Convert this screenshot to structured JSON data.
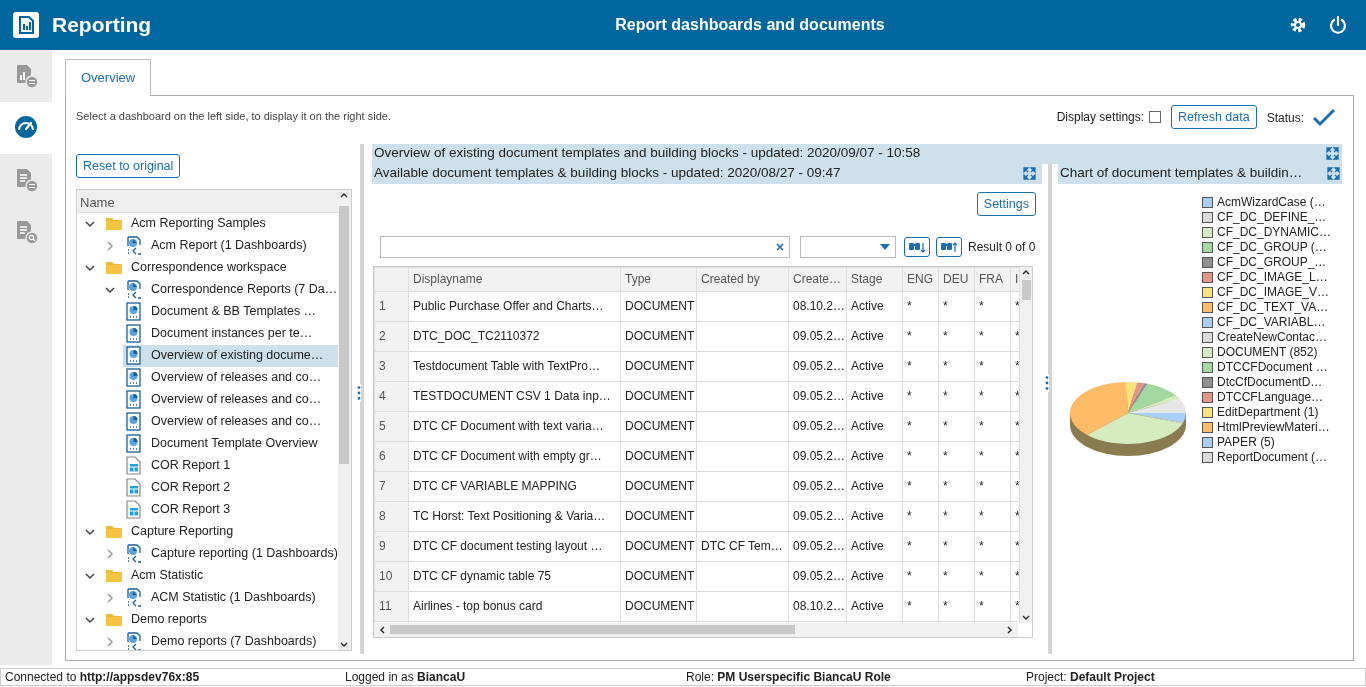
{
  "header": {
    "title": "Reporting",
    "subtitle": "Report dashboards and documents"
  },
  "sidebar": {
    "items": [
      {
        "kind": "report-settings",
        "selected": false
      },
      {
        "kind": "gauge",
        "selected": true
      },
      {
        "kind": "document-settings",
        "selected": false
      },
      {
        "kind": "document-search",
        "selected": false
      }
    ]
  },
  "tabs": [
    {
      "label": "Overview",
      "selected": true
    }
  ],
  "instruction": "Select a dashboard on the left side, to display it on the right side.",
  "display_settings": {
    "label": "Display settings:",
    "checked": false
  },
  "refresh_button": "Refresh data",
  "status": {
    "label": "Status:",
    "ok": true
  },
  "reset_button": "Reset to original",
  "tree": {
    "column": "Name",
    "items": [
      {
        "label": "Acm Reporting Samples",
        "kind": "folder",
        "expanded": true,
        "selected": false,
        "children": [
          {
            "label": "Acm Report (1 Dashboards)",
            "kind": "dashboard",
            "expanded": false,
            "selected": false
          }
        ]
      },
      {
        "label": "Correspondence workspace",
        "kind": "folder",
        "expanded": true,
        "selected": false,
        "children": [
          {
            "label": "Correspondence Reports (7 Da…",
            "kind": "dashboard",
            "expanded": true,
            "selected": false,
            "children": [
              {
                "label": "Document & BB Templates …",
                "kind": "chart",
                "selected": false
              },
              {
                "label": "Document instances per te…",
                "kind": "chart",
                "selected": false
              },
              {
                "label": "Overview of existing docume…",
                "kind": "chart",
                "selected": true
              },
              {
                "label": "Overview of releases and co…",
                "kind": "chart",
                "selected": false
              },
              {
                "label": "Overview of releases and co…",
                "kind": "chart",
                "selected": false
              },
              {
                "label": "Overview of releases and co…",
                "kind": "chart",
                "selected": false
              },
              {
                "label": "Document Template Overview",
                "kind": "chart",
                "selected": false
              },
              {
                "label": "COR Report 1",
                "kind": "report",
                "selected": false
              },
              {
                "label": "COR Report 2",
                "kind": "report",
                "selected": false
              },
              {
                "label": "COR Report 3",
                "kind": "report",
                "selected": false
              }
            ]
          }
        ]
      },
      {
        "label": "Capture Reporting",
        "kind": "folder",
        "expanded": true,
        "selected": false,
        "children": [
          {
            "label": "Capture reporting (1 Dashboards)",
            "kind": "dashboard",
            "expanded": false,
            "selected": false
          }
        ]
      },
      {
        "label": "Acm Statistic",
        "kind": "folder",
        "expanded": true,
        "selected": false,
        "children": [
          {
            "label": "ACM Statistic (1 Dashboards)",
            "kind": "dashboard",
            "expanded": false,
            "selected": false
          }
        ]
      },
      {
        "label": "Demo reports",
        "kind": "folder",
        "expanded": true,
        "selected": false,
        "children": [
          {
            "label": "Demo reports (7 Dashboards)",
            "kind": "dashboard",
            "expanded": false,
            "selected": false
          }
        ]
      }
    ]
  },
  "dashboard": {
    "title": "Overview of existing document templates and building blocks - updated: 2020/09/07 - 10:58",
    "table_panel": {
      "title": "Available document templates & building blocks - updated: 2020/08/27 - 09:47",
      "settings_button": "Settings",
      "result": "Result 0 of 0",
      "table": {
        "columns": [
          "",
          "Displayname",
          "Type",
          "Created by",
          "Create…",
          "Stage",
          "ENG",
          "DEU",
          "FRA",
          "I"
        ],
        "rows": [
          [
            "1",
            "Public Purchase Offer and Charts…",
            "DOCUMENT",
            "",
            "08.10.2…",
            "Active",
            "*",
            "*",
            "*",
            "*"
          ],
          [
            "2",
            "DTC_DOC_TC2110372",
            "DOCUMENT",
            "",
            "09.05.2…",
            "Active",
            "*",
            "*",
            "*",
            "*"
          ],
          [
            "3",
            "Testdocument Table with TextPro…",
            "DOCUMENT",
            "",
            "09.05.2…",
            "Active",
            "*",
            "*",
            "*",
            "*"
          ],
          [
            "4",
            "TESTDOCUMENT CSV 1 Data inp…",
            "DOCUMENT",
            "",
            "09.05.2…",
            "Active",
            "*",
            "*",
            "*",
            "*"
          ],
          [
            "5",
            "DTC CF Document with text varia…",
            "DOCUMENT",
            "",
            "09.05.2…",
            "Active",
            "*",
            "*",
            "*",
            "*"
          ],
          [
            "6",
            "DTC CF Document with empty gr…",
            "DOCUMENT",
            "",
            "09.05.2…",
            "Active",
            "*",
            "*",
            "*",
            "*"
          ],
          [
            "7",
            "DTC CF VARIABLE MAPPING",
            "DOCUMENT",
            "",
            "09.05.2…",
            "Active",
            "*",
            "*",
            "*",
            "*"
          ],
          [
            "8",
            "TC Horst: Text Positioning & Varia…",
            "DOCUMENT",
            "",
            "09.05.2…",
            "Active",
            "*",
            "*",
            "*",
            "*"
          ],
          [
            "9",
            "DTC CF document testing layout …",
            "DOCUMENT",
            "DTC CF Tem…",
            "09.05.2…",
            "Active",
            "*",
            "*",
            "*",
            "*"
          ],
          [
            "10",
            "DTC CF dynamic table 75",
            "DOCUMENT",
            "",
            "09.05.2…",
            "Active",
            "*",
            "*",
            "*",
            "*"
          ],
          [
            "11",
            "Airlines - top bonus card",
            "DOCUMENT",
            "",
            "08.10.2…",
            "Active",
            "*",
            "*",
            "*",
            "*"
          ]
        ]
      }
    },
    "chart_panel": {
      "title": "Chart of document templates & buildin…",
      "legend": [
        {
          "label": "AcmWizardCase (…",
          "color": "#a6d0f7"
        },
        {
          "label": "CF_DC_DEFINE_…",
          "color": "#dcdcdc"
        },
        {
          "label": "CF_DC_DYNAMIC…",
          "color": "#d5ecbe"
        },
        {
          "label": "CF_DC_GROUP (…",
          "color": "#a3d9a0"
        },
        {
          "label": "CF_DC_GROUP_…",
          "color": "#8f8f8f"
        },
        {
          "label": "CF_DC_IMAGE_L…",
          "color": "#e8938a"
        },
        {
          "label": "CF_DC_IMAGE_V…",
          "color": "#f8e57a"
        },
        {
          "label": "CF_DC_TEXT_VA…",
          "color": "#ffbb66"
        },
        {
          "label": "CF_DC_VARIABL…",
          "color": "#a6d0f7"
        },
        {
          "label": "CreateNewContac…",
          "color": "#dcdcdc"
        },
        {
          "label": "DOCUMENT (852)",
          "color": "#d5ecbe"
        },
        {
          "label": "DTCCFDocument …",
          "color": "#a3d9a0"
        },
        {
          "label": "DtcCfDocumentD…",
          "color": "#8f8f8f"
        },
        {
          "label": "DTCCFLanguage…",
          "color": "#e8938a"
        },
        {
          "label": "EditDepartment (1)",
          "color": "#f8e57a"
        },
        {
          "label": "HtmlPreviewMateri…",
          "color": "#ffbb66"
        },
        {
          "label": "PAPER (5)",
          "color": "#a6d0f7"
        },
        {
          "label": "ReportDocument (…",
          "color": "#dcdcdc"
        }
      ]
    }
  },
  "status_bar": [
    "Connected to **http://appsdev76x:85**",
    "Logged in as **BiancaU**",
    "Role: **PM Userspecific BiancaU Role**",
    "Project: **Default Project**"
  ]
}
